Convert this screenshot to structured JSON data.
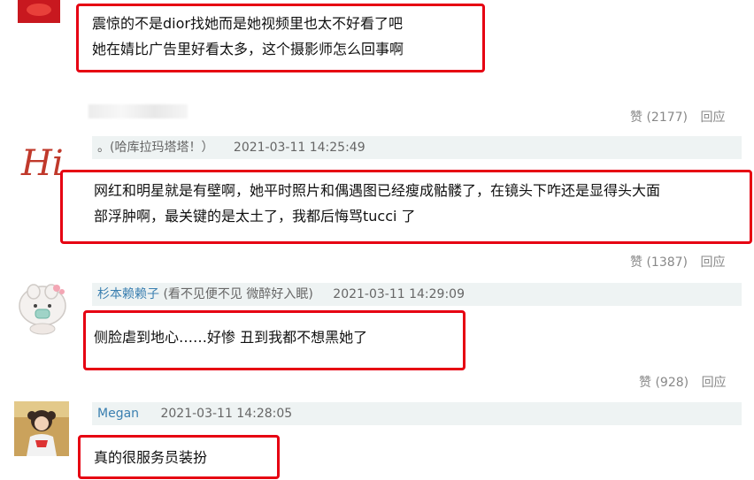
{
  "comments": [
    {
      "text_lines": [
        "震惊的不是dior找她而是她视频里也太不好看了吧",
        "她在婧比广告里好看太多，这个摄影师怎么回事啊"
      ],
      "likes_label": "赞 (2177)",
      "reply_label": "回应"
    },
    {
      "username": "",
      "note": "。(哈库拉玛塔塔！）",
      "time": "2021-03-11 14:25:49",
      "avatar_text": "Hi",
      "text_lines": [
        "网红和明星就是有壁啊，她平时照片和偶遇图已经瘦成骷髅了，在镜头下咋还是显得头大面",
        "部浮肿啊，最关键的是太土了，我都后悔骂tucci 了"
      ],
      "likes_label": "赞 (1387)",
      "reply_label": "回应"
    },
    {
      "username": "杉本赖赖子",
      "note": "(看不见便不见 微醉好入眠)",
      "time": "2021-03-11 14:29:09",
      "text_lines": [
        "侧脸虐到地心……好惨 丑到我都不想黑她了"
      ],
      "likes_label": "赞 (928)",
      "reply_label": "回应"
    },
    {
      "username": "Megan",
      "note": "",
      "time": "2021-03-11 14:28:05",
      "text_lines": [
        "真的很服务员装扮"
      ]
    }
  ]
}
